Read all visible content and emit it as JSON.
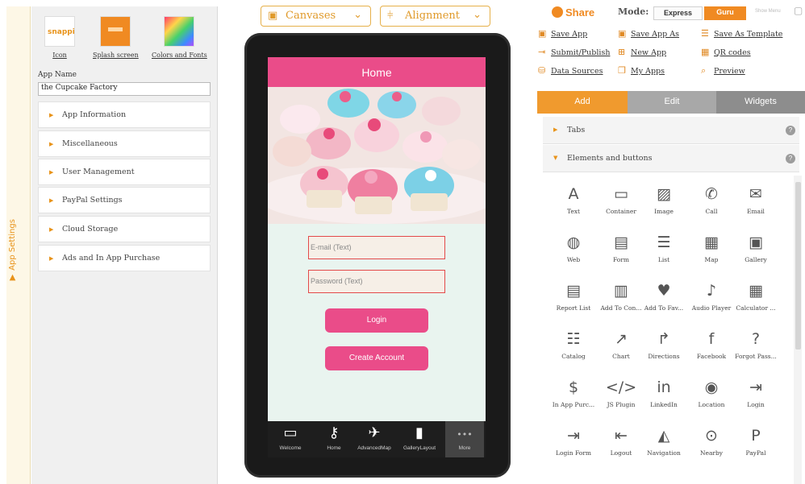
{
  "left_strip": {
    "label": "App Settings",
    "arrow": "▼"
  },
  "assets": [
    {
      "label": "Icon",
      "thumb": "snappii"
    },
    {
      "label": "Splash screen"
    },
    {
      "label": "Colors and Fonts"
    }
  ],
  "app_name": {
    "label": "App Name",
    "value": "the Cupcake Factory"
  },
  "settings_sections": [
    "App Information",
    "Miscellaneous",
    "User Management",
    "PayPal Settings",
    "Cloud Storage",
    "Ads and In App Purchase"
  ],
  "toolbar": {
    "canvases": "Canvases",
    "alignment": "Alignment"
  },
  "phone": {
    "title": "Home",
    "email_placeholder": "E-mail (Text)",
    "password_placeholder": "Password (Text)",
    "login": "Login",
    "create_account": "Create Account",
    "tabs": [
      "Welcome",
      "Home",
      "AdvancedMap",
      "GalleryLayout",
      "More"
    ]
  },
  "header": {
    "share": "Share",
    "mode_label": "Mode:",
    "mode_express": "Express",
    "mode_guru": "Guru",
    "show_menu": "Show Menu"
  },
  "actions": [
    {
      "label": "Save App",
      "icon": "save-icon"
    },
    {
      "label": "Save App As",
      "icon": "save-as-icon"
    },
    {
      "label": "Save As Template",
      "icon": "template-icon"
    },
    {
      "label": "Submit/Publish",
      "icon": "publish-icon"
    },
    {
      "label": "New App",
      "icon": "new-app-icon"
    },
    {
      "label": "QR codes",
      "icon": "qr-icon"
    },
    {
      "label": "Data Sources",
      "icon": "database-icon"
    },
    {
      "label": "My Apps",
      "icon": "apps-icon"
    },
    {
      "label": "Preview",
      "icon": "search-icon"
    }
  ],
  "tabs": [
    "Add",
    "Edit",
    "Widgets"
  ],
  "sections": [
    {
      "label": "Tabs",
      "expanded": false
    },
    {
      "label": "Elements and buttons",
      "expanded": true
    }
  ],
  "widgets": [
    {
      "label": "Text",
      "icon": "A"
    },
    {
      "label": "Container",
      "icon": "▭"
    },
    {
      "label": "Image",
      "icon": "▨"
    },
    {
      "label": "Call",
      "icon": "✆"
    },
    {
      "label": "Email",
      "icon": "✉"
    },
    {
      "label": "Web",
      "icon": "◍"
    },
    {
      "label": "Form",
      "icon": "▤"
    },
    {
      "label": "List",
      "icon": "☰"
    },
    {
      "label": "Map",
      "icon": "▦"
    },
    {
      "label": "Gallery",
      "icon": "▣"
    },
    {
      "label": "Report List",
      "icon": "▤"
    },
    {
      "label": "Add To Con...",
      "icon": "▥"
    },
    {
      "label": "Add To Fav...",
      "icon": "♥"
    },
    {
      "label": "Audio Player",
      "icon": "♪"
    },
    {
      "label": "Calculator ...",
      "icon": "▦"
    },
    {
      "label": "Catalog",
      "icon": "☷"
    },
    {
      "label": "Chart",
      "icon": "↗"
    },
    {
      "label": "Directions",
      "icon": "↱"
    },
    {
      "label": "Facebook",
      "icon": "f"
    },
    {
      "label": "Forgot Pass...",
      "icon": "?"
    },
    {
      "label": "In App Purc...",
      "icon": "$"
    },
    {
      "label": "JS Plugin",
      "icon": "</>"
    },
    {
      "label": "LinkedIn",
      "icon": "in"
    },
    {
      "label": "Location",
      "icon": "◉"
    },
    {
      "label": "Login",
      "icon": "⇥"
    },
    {
      "label": "Login Form",
      "icon": "⇥"
    },
    {
      "label": "Logout",
      "icon": "⇤"
    },
    {
      "label": "Navigation",
      "icon": "◭"
    },
    {
      "label": "Nearby",
      "icon": "⊙"
    },
    {
      "label": "PayPal",
      "icon": "P"
    }
  ],
  "colors": {
    "accent_orange": "#f08a22",
    "phone_pink": "#ea4c89"
  }
}
